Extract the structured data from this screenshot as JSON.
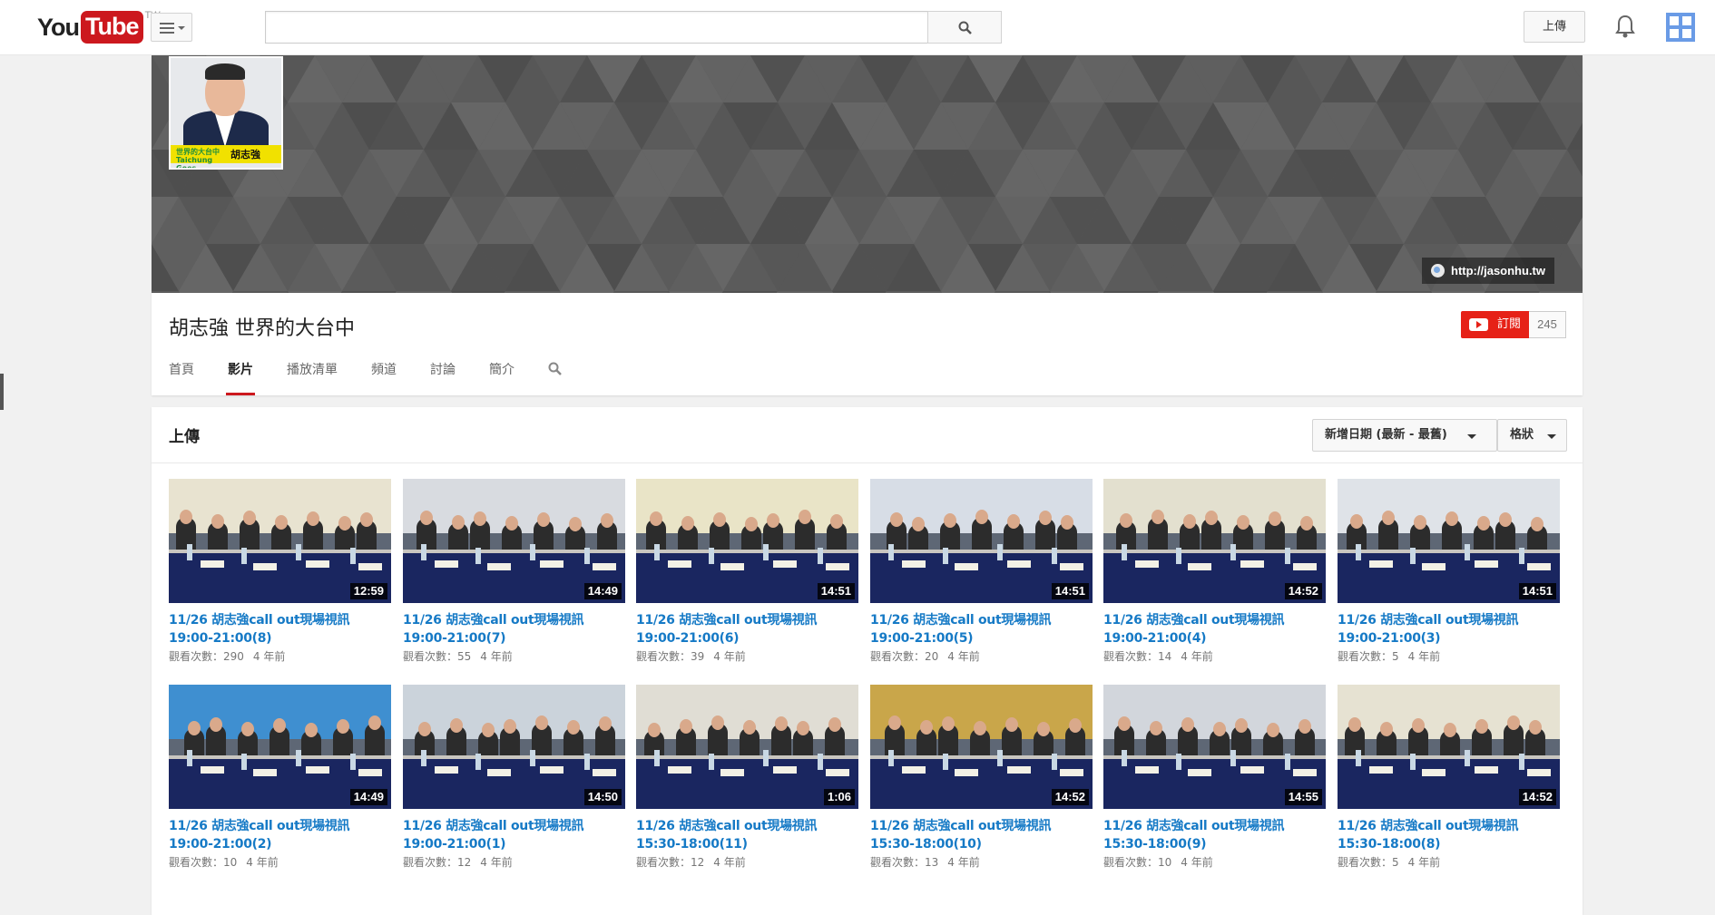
{
  "masthead": {
    "logo_you": "You",
    "logo_tube": "Tube",
    "logo_region": "TW",
    "search_placeholder": "",
    "upload_label": "上傳"
  },
  "channel": {
    "title": "胡志強 世界的大台中",
    "link_text": "http://jasonhu.tw",
    "subscribe_label": "訂閱",
    "subscriber_count": "245",
    "avatar_band_left": "世界的大台中 Taichung Goes Global",
    "avatar_band_name": "胡志強",
    "tabs": [
      {
        "label": "首頁",
        "active": false
      },
      {
        "label": "影片",
        "active": true
      },
      {
        "label": "播放清單",
        "active": false
      },
      {
        "label": "頻道",
        "active": false
      },
      {
        "label": "討論",
        "active": false
      },
      {
        "label": "簡介",
        "active": false
      }
    ]
  },
  "uploads": {
    "title": "上傳",
    "sort_label": "新增日期 (最新 - 最舊)",
    "view_label": "格狀",
    "videos": [
      {
        "title": "11/26 胡志強call out現場視訊 19:00-21:00(8)",
        "duration": "12:59",
        "views": "觀看次數：290",
        "ago": "4 年前"
      },
      {
        "title": "11/26 胡志強call out現場視訊 19:00-21:00(7)",
        "duration": "14:49",
        "views": "觀看次數：55",
        "ago": "4 年前"
      },
      {
        "title": "11/26 胡志強call out現場視訊 19:00-21:00(6)",
        "duration": "14:51",
        "views": "觀看次數：39",
        "ago": "4 年前"
      },
      {
        "title": "11/26 胡志強call out現場視訊 19:00-21:00(5)",
        "duration": "14:51",
        "views": "觀看次數：20",
        "ago": "4 年前"
      },
      {
        "title": "11/26 胡志強call out現場視訊 19:00-21:00(4)",
        "duration": "14:52",
        "views": "觀看次數：14",
        "ago": "4 年前"
      },
      {
        "title": "11/26 胡志強call out現場視訊 19:00-21:00(3)",
        "duration": "14:51",
        "views": "觀看次數：5",
        "ago": "4 年前"
      },
      {
        "title": "11/26 胡志強call out現場視訊 19:00-21:00(2)",
        "duration": "14:49",
        "views": "觀看次數：10",
        "ago": "4 年前"
      },
      {
        "title": "11/26 胡志強call out現場視訊 19:00-21:00(1)",
        "duration": "14:50",
        "views": "觀看次數：12",
        "ago": "4 年前"
      },
      {
        "title": "11/26 胡志強call out現場視訊 15:30-18:00(11)",
        "duration": "1:06",
        "views": "觀看次數：12",
        "ago": "4 年前"
      },
      {
        "title": "11/26 胡志強call out現場視訊 15:30-18:00(10)",
        "duration": "14:52",
        "views": "觀看次數：13",
        "ago": "4 年前"
      },
      {
        "title": "11/26 胡志強call out現場視訊 15:30-18:00(9)",
        "duration": "14:55",
        "views": "觀看次數：10",
        "ago": "4 年前"
      },
      {
        "title": "11/26 胡志強call out現場視訊 15:30-18:00(8)",
        "duration": "14:52",
        "views": "觀看次數：5",
        "ago": "4 年前"
      }
    ]
  },
  "colors": {
    "brand_red": "#cc181e",
    "subscribe_red": "#e62117",
    "link_blue": "#167ac6"
  }
}
